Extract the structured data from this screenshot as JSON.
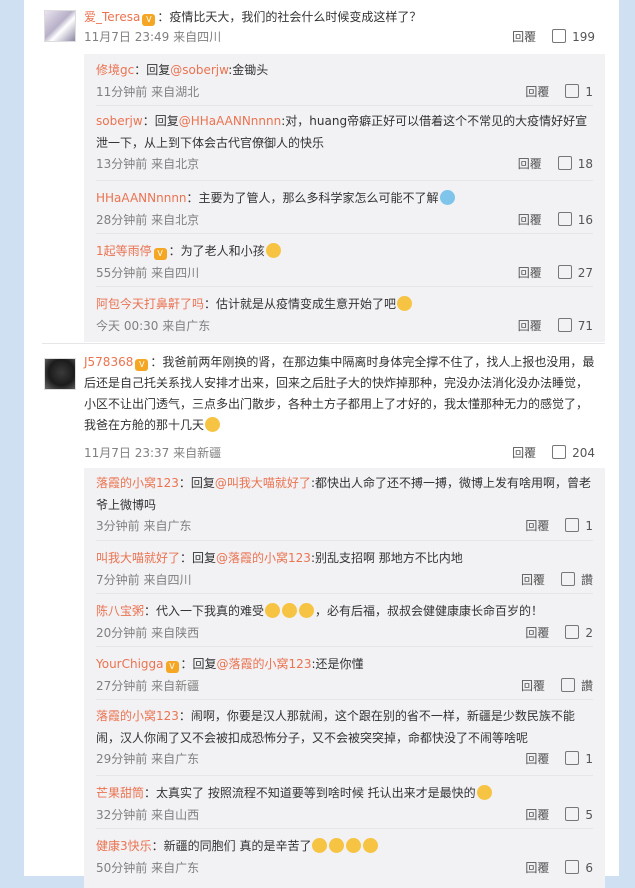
{
  "threads": [
    {
      "user": "爱_Teresa",
      "text": "：疫情比天大，我们的社会什么时候变成这样了？",
      "time": "11月7日 23:49 来自四川",
      "reply_label": "回覆",
      "likes": "199",
      "replies": [
        {
          "user": "修境gc",
          "prefix": "：回复",
          "mention": "@soberjw",
          "text": ":金锄头",
          "emoji": "",
          "time": "11分钟前 来自湖北",
          "likes": "1"
        },
        {
          "user": "soberjw",
          "prefix": "：回复",
          "mention": "@HHaAANNnnnn",
          "text": ":对，huang帝癖正好可以借着这个不常见的大疫情好好宣泄一下，从上到下体会古代官僚御人的快乐",
          "emoji": "",
          "time": "13分钟前 来自北京",
          "likes": "18"
        },
        {
          "user": "HHaAANNnnnn",
          "prefix": "",
          "mention": "",
          "text": "：主要为了管人，那么多科学家怎么可能不了解",
          "emoji": "💊",
          "time": "28分钟前 来自北京",
          "likes": "16"
        },
        {
          "user": "1起等雨停",
          "prefix": "",
          "mention": "",
          "text": "：为了老人和小孩",
          "emoji": "😁",
          "time": "55分钟前 来自四川",
          "likes": "27"
        },
        {
          "user": "阿包今天打鼻鼾了吗",
          "prefix": "",
          "mention": "",
          "text": "：估计就是从疫情变成生意开始了吧",
          "emoji": "😭",
          "time": "今天 00:30 来自广东",
          "likes": "71"
        }
      ]
    },
    {
      "user": "J578368",
      "text": "：我爸前两年刚换的肾，在那边集中隔离时身体完全撑不住了，找人上报也没用，最后还是自己托关系找人安排才出来，回来之后肚子大的快炸掉那种，完没办法消化没办法睡觉，小区不让出门透气，三点多出门散步，各种土方子都用上了才好的，我太懂那种无力的感觉了，我爸在方舱的那十几天",
      "emoji": "😭",
      "time": "11月7日 23:37 来自新疆",
      "reply_label": "回覆",
      "likes": "204",
      "replies": [
        {
          "user": "落霞的小窝123",
          "prefix": "：回复",
          "mention": "@叫我大喵就好了",
          "text": ":都快出人命了还不搏一搏，微博上发有啥用啊，曾老爷上微博吗",
          "emoji": "",
          "time": "3分钟前 来自广东",
          "likes": "1"
        },
        {
          "user": "叫我大喵就好了",
          "prefix": "：回复",
          "mention": "@落霞的小窝123",
          "text": ":别乱支招啊 那地方不比内地",
          "emoji": "",
          "time": "7分钟前 来自四川",
          "likes": "讚"
        },
        {
          "user": "陈八宝粥",
          "prefix": "",
          "mention": "",
          "text": "：代入一下我真的难受",
          "emoji": "😭😭😭",
          "text2": "，必有后福，叔叔会健健康康长命百岁的！",
          "time": "20分钟前 来自陕西",
          "likes": "2"
        },
        {
          "user": "YourChigga",
          "prefix": "：回复",
          "mention": "@落霞的小窝123",
          "text": ":还是你懂",
          "emoji": "",
          "time": "27分钟前 来自新疆",
          "likes": "讚"
        },
        {
          "user": "落霞的小窝123",
          "prefix": "",
          "mention": "",
          "text": "：闹啊，你要是汉人那就闹，这个跟在别的省不一样，新疆是少数民族不能闹，汉人你闹了又不会被扣成恐怖分子，又不会被突突掉，命都快没了不闹等啥呢",
          "emoji": "",
          "time": "29分钟前 来自广东",
          "likes": "1"
        },
        {
          "user": "芒果甜筒",
          "prefix": "",
          "mention": "",
          "text": "：太真实了 按照流程不知道要等到啥时候 托认出来才是最快的",
          "emoji": "😭",
          "time": "32分钟前 来自山西",
          "likes": "5"
        },
        {
          "user": "健康3快乐",
          "prefix": "",
          "mention": "",
          "text": "：新疆的同胞们 真的是辛苦了",
          "emoji": "😭😭😭😭",
          "time": "50分钟前 来自广东",
          "likes": "6"
        }
      ]
    }
  ]
}
